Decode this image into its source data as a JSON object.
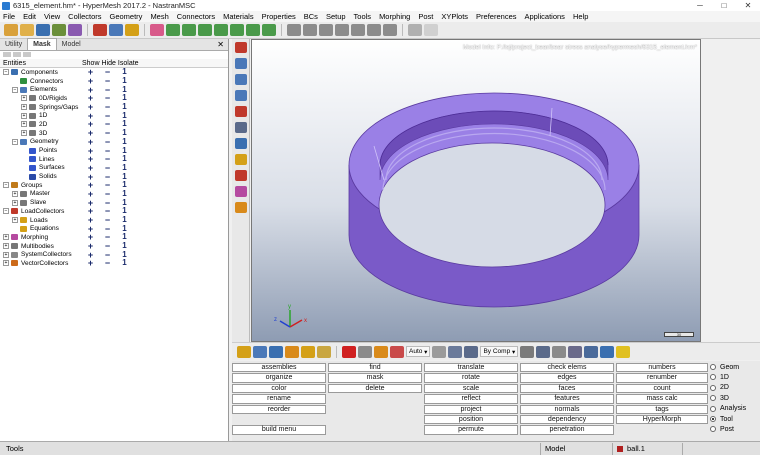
{
  "window": {
    "title": "6315_element.hm* - HyperMesh 2017.2 - NastranMSC",
    "controls": [
      "─",
      "□",
      "✕"
    ]
  },
  "menubar": [
    "File",
    "Edit",
    "View",
    "Collectors",
    "Geometry",
    "Mesh",
    "Connectors",
    "Materials",
    "Properties",
    "BCs",
    "Setup",
    "Tools",
    "Morphing",
    "Post",
    "XYPlots",
    "Preferences",
    "Applications",
    "Help"
  ],
  "left_panel": {
    "tabs": [
      "Utility",
      "Mask",
      "Model"
    ],
    "active_tab": "Mask",
    "close_glyph": "✕",
    "header": {
      "entities": "Entities",
      "show": "Show",
      "hide": "Hide",
      "isolate": "Isolate"
    },
    "tree": [
      {
        "label": "Components",
        "level": 0,
        "expand": "−",
        "icon_color": "#3a6fb0"
      },
      {
        "label": "Connectors",
        "level": 1,
        "expand": "",
        "icon_color": "#2f8f3f"
      },
      {
        "label": "Elements",
        "level": 1,
        "expand": "−",
        "icon_color": "#4a78b8"
      },
      {
        "label": "0D/Rigids",
        "level": 2,
        "expand": "+",
        "icon_color": "#777777"
      },
      {
        "label": "Springs/Gaps",
        "level": 2,
        "expand": "+",
        "icon_color": "#777777"
      },
      {
        "label": "1D",
        "level": 2,
        "expand": "+",
        "icon_color": "#777777"
      },
      {
        "label": "2D",
        "level": 2,
        "expand": "+",
        "icon_color": "#777777"
      },
      {
        "label": "3D",
        "level": 2,
        "expand": "+",
        "icon_color": "#777777"
      },
      {
        "label": "Geometry",
        "level": 1,
        "expand": "−",
        "icon_color": "#4a78b8"
      },
      {
        "label": "Points",
        "level": 2,
        "expand": "",
        "icon_color": "#3355cc"
      },
      {
        "label": "Lines",
        "level": 2,
        "expand": "",
        "icon_color": "#3355cc"
      },
      {
        "label": "Surfaces",
        "level": 2,
        "expand": "",
        "icon_color": "#3355cc"
      },
      {
        "label": "Solids",
        "level": 2,
        "expand": "",
        "icon_color": "#2a4aa8"
      },
      {
        "label": "Groups",
        "level": 0,
        "expand": "−",
        "icon_color": "#c07a1a"
      },
      {
        "label": "Master",
        "level": 1,
        "expand": "+",
        "icon_color": "#777777"
      },
      {
        "label": "Slave",
        "level": 1,
        "expand": "+",
        "icon_color": "#777777"
      },
      {
        "label": "LoadCollectors",
        "level": 0,
        "expand": "−",
        "icon_color": "#c0392b"
      },
      {
        "label": "Loads",
        "level": 1,
        "expand": "+",
        "icon_color": "#d4a017"
      },
      {
        "label": "Equations",
        "level": 1,
        "expand": "",
        "icon_color": "#d4a017"
      },
      {
        "label": "Morphing",
        "level": 0,
        "expand": "+",
        "icon_color": "#b54aa0"
      },
      {
        "label": "Multibodies",
        "level": 0,
        "expand": "+",
        "icon_color": "#777777"
      },
      {
        "label": "SystemCollectors",
        "level": 0,
        "expand": "+",
        "icon_color": "#888888"
      },
      {
        "label": "VectorCollectors",
        "level": 0,
        "expand": "+",
        "icon_color": "#cc6a1a"
      }
    ],
    "show_glyph": "+",
    "hide_glyph": "−",
    "isolate_glyph": "1"
  },
  "viewport": {
    "model_info": "Model Info: F:/lsj/project_bear/bear stress analyse/hypermesh/6315_element.hm*",
    "scale_label": "30",
    "model_color": "#8a6ad8",
    "axis": {
      "x": "x",
      "y": "y",
      "z": "z"
    }
  },
  "bottom_toolbar": {
    "auto_label": "Auto",
    "bycomp_label": "By Comp"
  },
  "utility_panel": {
    "buttons": [
      [
        "assemblies",
        "find",
        "translate",
        "check elems",
        "numbers"
      ],
      [
        "organize",
        "mask",
        "rotate",
        "edges",
        "renumber"
      ],
      [
        "color",
        "delete",
        "scale",
        "faces",
        "count"
      ],
      [
        "rename",
        "",
        "reflect",
        "features",
        "mass calc"
      ],
      [
        "reorder",
        "",
        "project",
        "normals",
        "tags"
      ],
      [
        "",
        "",
        "position",
        "dependency",
        "HyperMorph"
      ],
      [
        "build menu",
        "",
        "permute",
        "penetration",
        ""
      ]
    ],
    "radios": [
      "Geom",
      "1D",
      "2D",
      "3D",
      "Analysis",
      "Tool",
      "Post"
    ],
    "selected_radio": "Tool"
  },
  "statusbar": {
    "left": "Tools",
    "model": "Model",
    "component": "ball.1"
  }
}
